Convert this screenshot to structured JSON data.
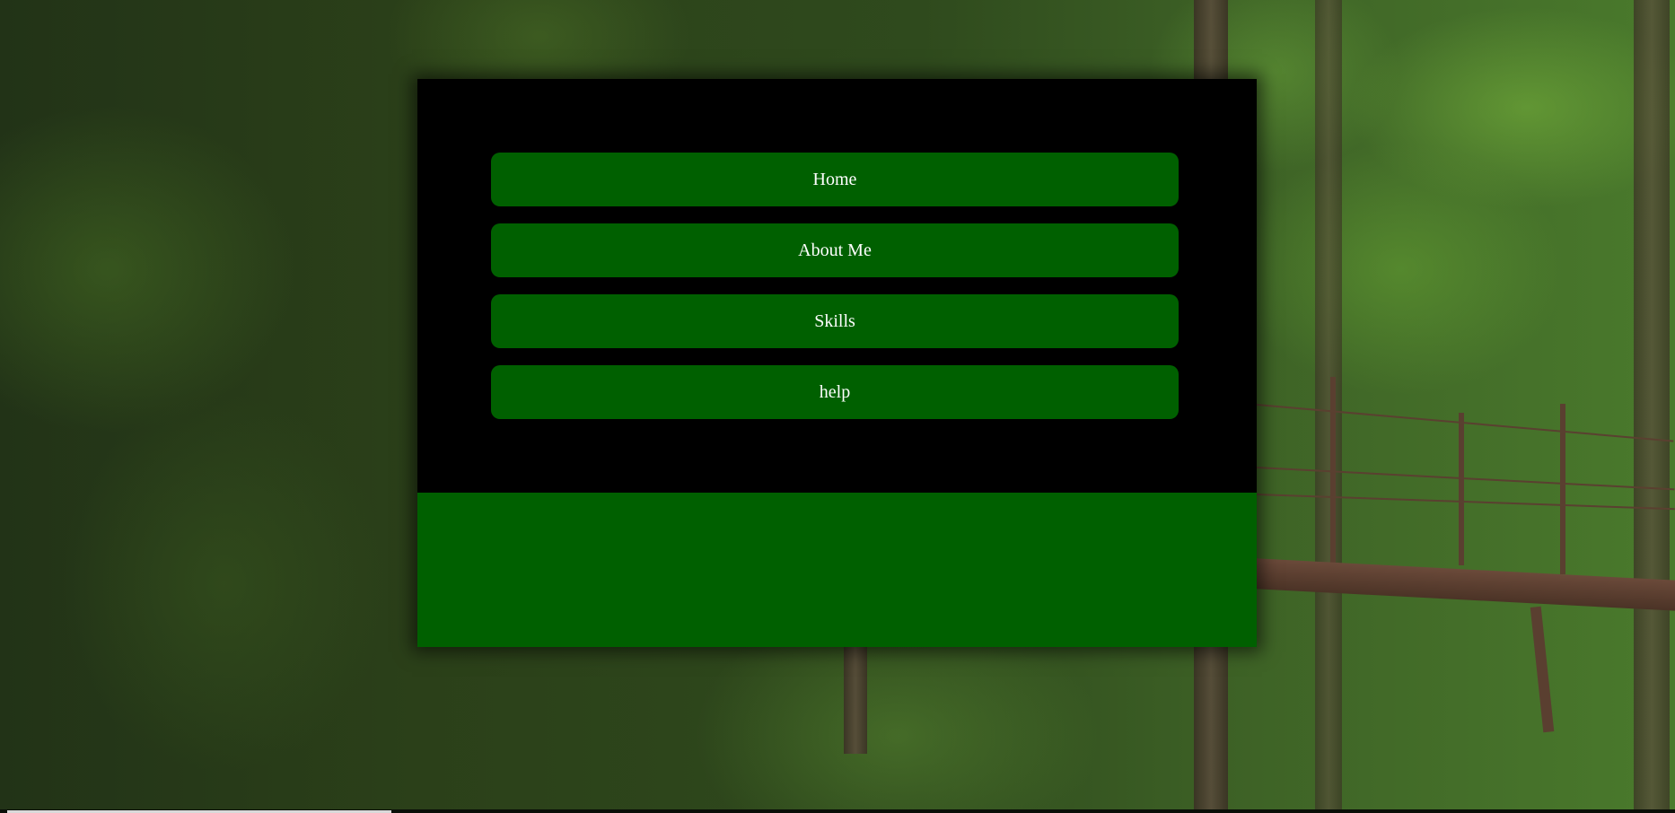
{
  "nav": {
    "items": [
      {
        "label": "Home"
      },
      {
        "label": "About Me"
      },
      {
        "label": "Skills"
      },
      {
        "label": "help"
      }
    ]
  },
  "colors": {
    "panel_background": "#000000",
    "button_background": "#006000",
    "button_text": "#ffffff",
    "footer_background": "#006000"
  },
  "background": {
    "icon": "forest-background-image"
  }
}
